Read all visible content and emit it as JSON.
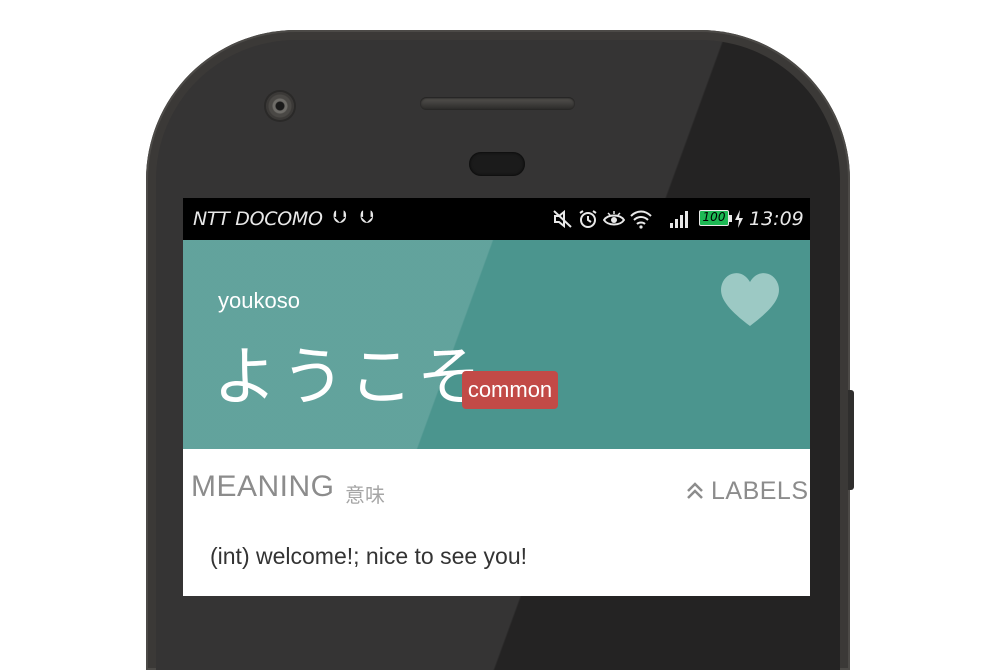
{
  "status_bar": {
    "carrier": "NTT DOCOMO",
    "usb_icons": [
      "usb-icon",
      "usb-icon"
    ],
    "icons": [
      "mute-icon",
      "alarm-icon",
      "eye-icon",
      "wifi-icon",
      "signal-icon"
    ],
    "battery_level": "100",
    "battery_color": "#1db954",
    "time": "13:09"
  },
  "word": {
    "romaji": "youkoso",
    "kana": "ようこそ",
    "badge": "common",
    "badge_color": "#c24a47",
    "header_color": "#4b958e",
    "favorite_icon": "heart-icon"
  },
  "meaning_section": {
    "title": "MEANING",
    "title_jp": "意味",
    "labels_toggle": "LABELS",
    "labels_icon": "double-chevron-up-icon",
    "definition": "(int) welcome!; nice to see you!"
  }
}
